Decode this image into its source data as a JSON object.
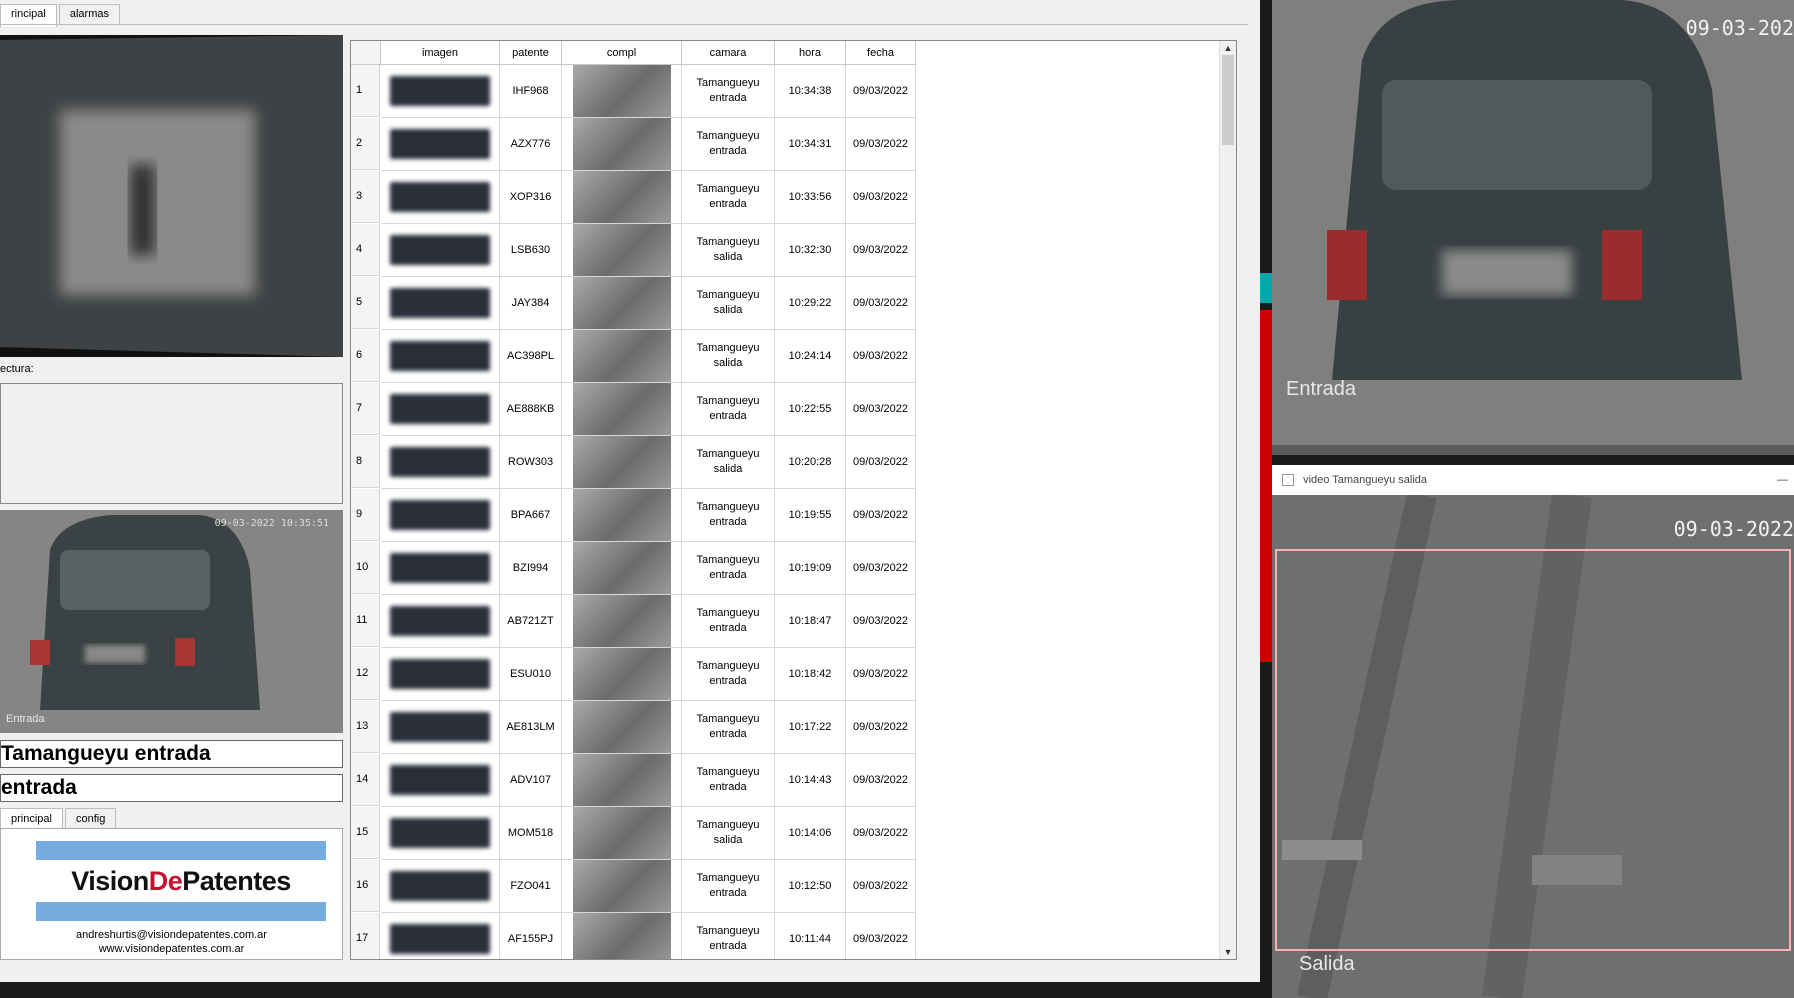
{
  "tabs": {
    "principal": "rincipal",
    "alarmas": "alarmas"
  },
  "lectura_label": "ectura:",
  "snapshot": {
    "timestamp": "09-03-2022 10:35:51",
    "caption": "Entrada"
  },
  "camera_name": "Tamangueyu entrada",
  "direction": "entrada",
  "subtabs": {
    "principal": "principal",
    "config": "config"
  },
  "logo": {
    "part1": "Vision",
    "part2": "De",
    "part3": "Patentes"
  },
  "contact": {
    "email": "andreshurtis@visiondepatentes.com.ar",
    "web": "www.visiondepatentes.com.ar"
  },
  "table": {
    "headers": {
      "imagen": "imagen",
      "patente": "patente",
      "compl": "compl",
      "camara": "camara",
      "hora": "hora",
      "fecha": "fecha"
    },
    "rows": [
      {
        "n": "1",
        "patente": "IHF968",
        "camara": "Tamangueyu entrada",
        "hora": "10:34:38",
        "fecha": "09/03/2022"
      },
      {
        "n": "2",
        "patente": "AZX776",
        "camara": "Tamangueyu entrada",
        "hora": "10:34:31",
        "fecha": "09/03/2022"
      },
      {
        "n": "3",
        "patente": "XOP316",
        "camara": "Tamangueyu entrada",
        "hora": "10:33:56",
        "fecha": "09/03/2022"
      },
      {
        "n": "4",
        "patente": "LSB630",
        "camara": "Tamangueyu salida",
        "hora": "10:32:30",
        "fecha": "09/03/2022"
      },
      {
        "n": "5",
        "patente": "JAY384",
        "camara": "Tamangueyu salida",
        "hora": "10:29:22",
        "fecha": "09/03/2022"
      },
      {
        "n": "6",
        "patente": "AC398PL",
        "camara": "Tamangueyu salida",
        "hora": "10:24:14",
        "fecha": "09/03/2022"
      },
      {
        "n": "7",
        "patente": "AE888KB",
        "camara": "Tamangueyu entrada",
        "hora": "10:22:55",
        "fecha": "09/03/2022"
      },
      {
        "n": "8",
        "patente": "ROW303",
        "camara": "Tamangueyu salida",
        "hora": "10:20:28",
        "fecha": "09/03/2022"
      },
      {
        "n": "9",
        "patente": "BPA667",
        "camara": "Tamangueyu entrada",
        "hora": "10:19:55",
        "fecha": "09/03/2022"
      },
      {
        "n": "10",
        "patente": "BZI994",
        "camara": "Tamangueyu entrada",
        "hora": "10:19:09",
        "fecha": "09/03/2022"
      },
      {
        "n": "11",
        "patente": "AB721ZT",
        "camara": "Tamangueyu entrada",
        "hora": "10:18:47",
        "fecha": "09/03/2022"
      },
      {
        "n": "12",
        "patente": "ESU010",
        "camara": "Tamangueyu entrada",
        "hora": "10:18:42",
        "fecha": "09/03/2022"
      },
      {
        "n": "13",
        "patente": "AE813LM",
        "camara": "Tamangueyu entrada",
        "hora": "10:17:22",
        "fecha": "09/03/2022"
      },
      {
        "n": "14",
        "patente": "ADV107",
        "camara": "Tamangueyu entrada",
        "hora": "10:14:43",
        "fecha": "09/03/2022"
      },
      {
        "n": "15",
        "patente": "MOM518",
        "camara": "Tamangueyu salida",
        "hora": "10:14:06",
        "fecha": "09/03/2022"
      },
      {
        "n": "16",
        "patente": "FZO041",
        "camara": "Tamangueyu entrada",
        "hora": "10:12:50",
        "fecha": "09/03/2022"
      },
      {
        "n": "17",
        "patente": "AF155PJ",
        "camara": "Tamangueyu entrada",
        "hora": "10:11:44",
        "fecha": "09/03/2022"
      }
    ]
  },
  "video1": {
    "timestamp": "09-03-202",
    "caption": "Entrada"
  },
  "video2": {
    "title": "video Tamangueyu salida",
    "timestamp": "09-03-2022",
    "caption": "Salida",
    "minimize": "—"
  }
}
